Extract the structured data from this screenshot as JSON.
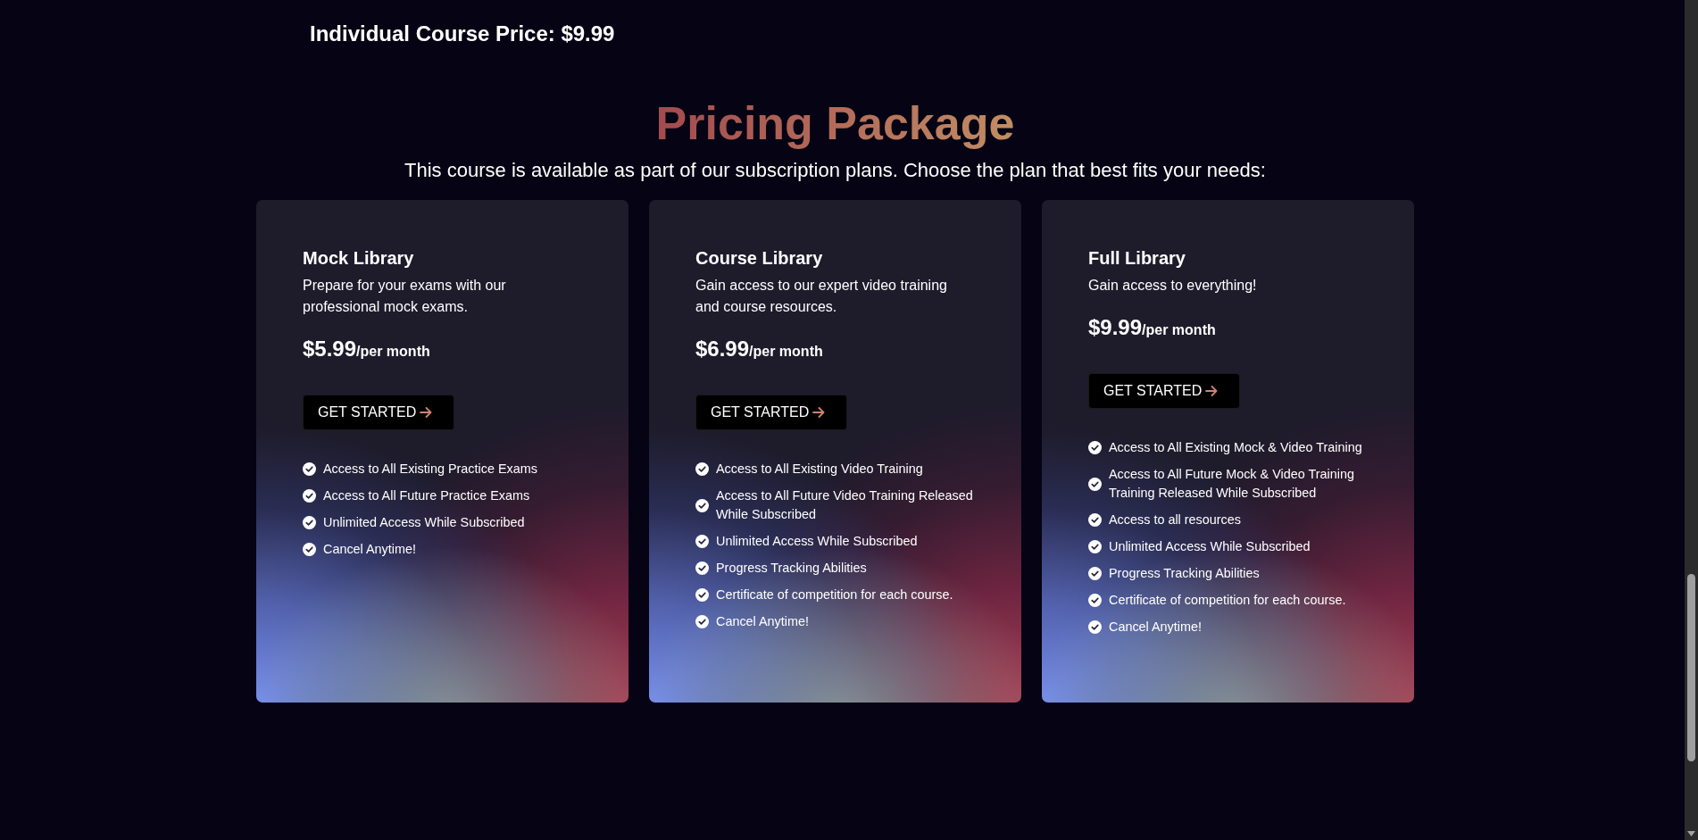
{
  "individual_price": "Individual Course Price: $9.99",
  "pricing": {
    "title": "Pricing Package",
    "subtitle": "This course is available as part of our subscription plans. Choose the plan that best fits your needs:",
    "plans": [
      {
        "name": "Mock Library",
        "description": "Prepare for your exams with our professional mock exams.",
        "price": "$5.99",
        "period": "/per month",
        "button": "GET STARTED",
        "features": [
          "Access to All Existing Practice Exams",
          "Access to All Future Practice Exams",
          "Unlimited Access While Subscribed",
          "Cancel Anytime!"
        ]
      },
      {
        "name": "Course Library",
        "description": "Gain access to our expert video training and course resources.",
        "price": "$6.99",
        "period": "/per month",
        "button": "GET STARTED",
        "features": [
          "Access to All Existing Video Training",
          "Access to All Future Video Training Released While Subscribed",
          "Unlimited Access While Subscribed",
          "Progress Tracking Abilities",
          "Certificate of competition for each course.",
          "Cancel Anytime!"
        ]
      },
      {
        "name": "Full Library",
        "description": "Gain access to everything!",
        "price": "$9.99",
        "period": "/per month",
        "button": "GET STARTED",
        "features": [
          "Access to All Existing Mock & Video Training",
          "Access to All Future Mock & Video Training Training Released While Subscribed",
          "Access to all resources",
          "Unlimited Access While Subscribed",
          "Progress Tracking Abilities",
          "Certificate of competition for each course.",
          "Cancel Anytime!"
        ]
      }
    ]
  }
}
